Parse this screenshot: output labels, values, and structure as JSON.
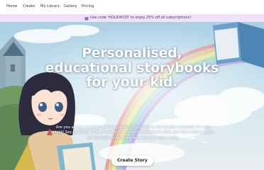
{
  "nav": {
    "items": [
      {
        "label": "Home"
      },
      {
        "label": "Create"
      },
      {
        "label": "My Library"
      },
      {
        "label": "Gallery"
      },
      {
        "label": "Pricing"
      }
    ]
  },
  "banner": {
    "icon": "gift-icon",
    "text": "Use code 'HOLIDAY25' to enjoy 25% off all subscriptions!"
  },
  "hero": {
    "title": "Personalised, educational storybooks for your kid.",
    "subtitle": "Are you a time-strapped working parent struggling to find quality storytime for your child? Say goodbye to the frustration of repetitive bedtime tales and the endless quest for the right book. Start weaving your tales today.",
    "cta_label": "Create Story"
  },
  "colors": {
    "nav_background": "#ffffff",
    "banner_background": "#eee3f8",
    "sky": "#bfe0ef",
    "cta_background": "#ffffff"
  }
}
